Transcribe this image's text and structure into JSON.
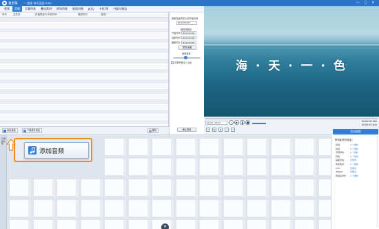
{
  "titlebar": {
    "app_name": "爱剪辑",
    "project_name": "— 超级 海天画面.mep",
    "controls": [
      "—",
      "□",
      "✕"
    ]
  },
  "menu": {
    "tabs": [
      {
        "label": "视频",
        "active": false
      },
      {
        "label": "音频",
        "active": true
      },
      {
        "label": "字幕特效",
        "active": false
      },
      {
        "label": "叠加素材",
        "active": false
      },
      {
        "label": "转场特效",
        "active": false
      },
      {
        "label": "画面风格",
        "active": false
      },
      {
        "label": "MTV",
        "active": false
      },
      {
        "label": "卡拉OK",
        "active": false
      },
      {
        "label": "升级与服务",
        "active": false
      }
    ]
  },
  "audio_table": {
    "columns": [
      "序号",
      "文件名",
      "在最终影片中的时间",
      "裁剪时长",
      "路径"
    ],
    "row_count": 23
  },
  "audio_settings": {
    "section_time": "音频在最终影片的开始时间",
    "start_time_value": "00:00:00.000",
    "section_clip": "裁剪原音频",
    "start_label": "开始时间",
    "end_label": "结束时间",
    "duration_label": "截取时长",
    "start_value": "00:00:00.000",
    "end_value": "00:00:00.000",
    "duration_value": "00:00:00.000",
    "preview_button": "预览/截取",
    "section_volume": "音频音量",
    "volume_level": 0.45,
    "checkbox_label": "头尾声音淡入淡出",
    "confirm_button": "确认修改"
  },
  "left_toolbar": {
    "add_audio": "添加音频",
    "download_more": "下载更多音效",
    "delete": "删除"
  },
  "preview": {
    "overlay_text": "海 · 天 · 一 · 色"
  },
  "player": {
    "time_left": "00:00 / 01:25",
    "time_current": "00:00:00.000",
    "time_total": "00:00:49.640",
    "export_button": "导出视频"
  },
  "timeline": {
    "side_tab": "已添加片段",
    "highlight_button": "添加音频"
  },
  "info_panel": {
    "title": "所有制作的信息：",
    "rows": [
      {
        "label": "视频：",
        "value": "2 个素材"
      },
      {
        "label": "音频：",
        "value": "0 个素材"
      },
      {
        "label": "字幕特效：",
        "value": "0 个素材"
      },
      {
        "label": "转场：",
        "value": "0 个素材"
      },
      {
        "label": "画面风格：",
        "value": "无特效"
      },
      {
        "label": "叠加素材：",
        "value": "0 个素材"
      },
      {
        "label": "MTV：",
        "value": "无歌词"
      },
      {
        "label": "卡拉OK：",
        "value": "无歌词"
      },
      {
        "label": "视频总时长：",
        "value": "0 个素材"
      }
    ]
  },
  "colors": {
    "accent": "#2f7fd8",
    "titlebar": "#2a74c9",
    "highlight": "#f28a1c"
  },
  "icons": [
    "music-note-icon",
    "download-icon",
    "delete-icon",
    "play-icon",
    "pause-icon",
    "stop-icon",
    "arrow-up-icon",
    "close-icon"
  ]
}
